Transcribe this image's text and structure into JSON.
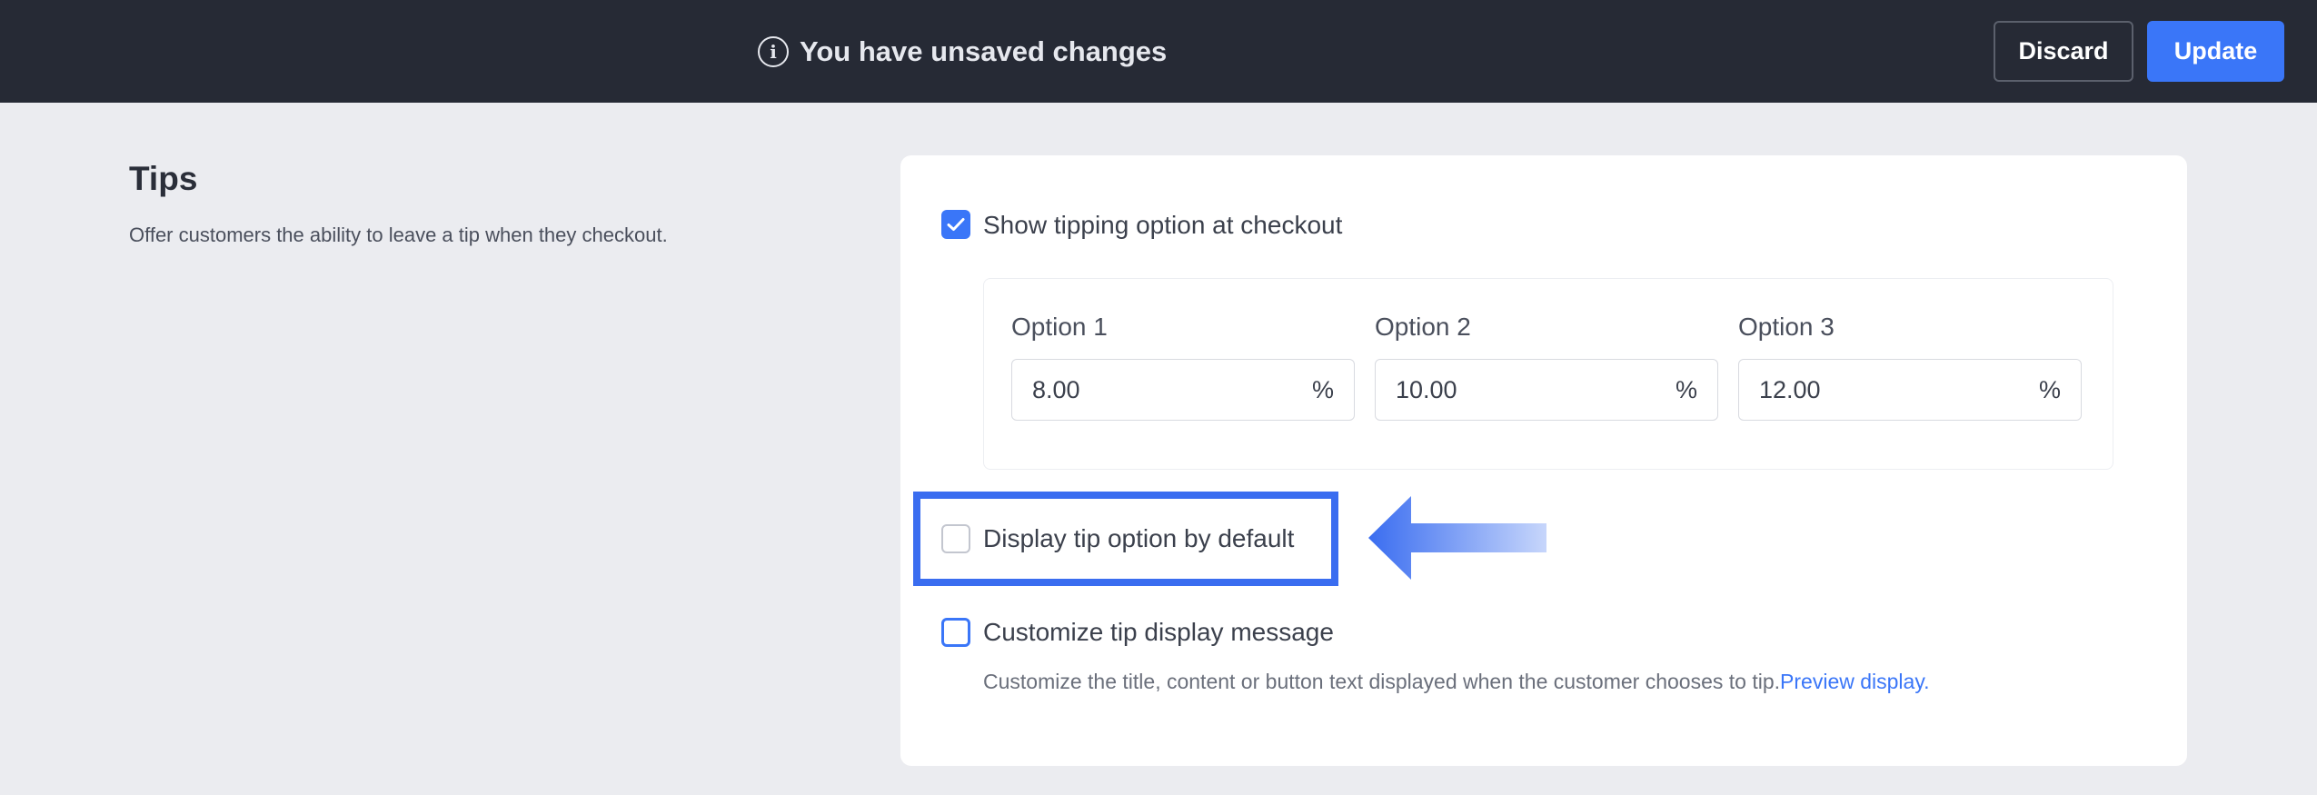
{
  "topbar": {
    "message": "You have unsaved changes",
    "discard_label": "Discard",
    "update_label": "Update"
  },
  "section": {
    "title": "Tips",
    "description": "Offer customers the ability to leave a tip when they checkout."
  },
  "tipping": {
    "show_option_label": "Show tipping option at checkout",
    "show_option_checked": true,
    "options": [
      {
        "label": "Option 1",
        "value": "8.00",
        "unit": "%"
      },
      {
        "label": "Option 2",
        "value": "10.00",
        "unit": "%"
      },
      {
        "label": "Option 3",
        "value": "12.00",
        "unit": "%"
      }
    ],
    "display_default_label": "Display tip option by default",
    "display_default_checked": false,
    "customize_label": "Customize tip display message",
    "customize_checked": false,
    "customize_help": "Customize the title, content or button text displayed when the customer chooses to tip.",
    "preview_link": "Preview display."
  },
  "colors": {
    "topbar_bg": "#262a35",
    "accent": "#3a76f8",
    "page_bg": "#ebecf0",
    "annotation": "#3a6df0"
  },
  "icons": {
    "info": "info-icon",
    "check": "check-icon",
    "arrow": "left-arrow-annotation"
  }
}
